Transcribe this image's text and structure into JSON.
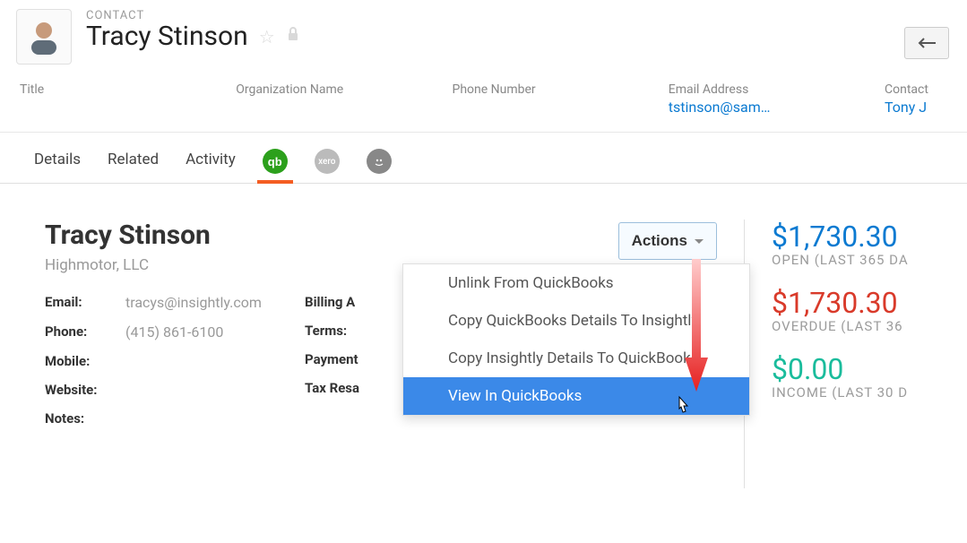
{
  "header": {
    "section_label": "CONTACT",
    "name": "Tracy Stinson"
  },
  "meta": {
    "title_label": "Title",
    "org_label": "Organization Name",
    "phone_label": "Phone Number",
    "email_label": "Email Address",
    "email_value": "tstinson@sam…",
    "owner_label": "Contact",
    "owner_value": "Tony J"
  },
  "tabs": {
    "details": "Details",
    "related": "Related",
    "activity": "Activity",
    "xero": "xero"
  },
  "panel": {
    "name": "Tracy Stinson",
    "company": "Highmotor, LLC",
    "left": {
      "email_lbl": "Email:",
      "email_val": "tracys@insightly.com",
      "phone_lbl": "Phone:",
      "phone_val": "(415) 861-6100",
      "mobile_lbl": "Mobile:",
      "website_lbl": "Website:",
      "notes_lbl": "Notes:"
    },
    "right": {
      "billing_lbl": "Billing A",
      "terms_lbl": "Terms:",
      "payment_lbl": "Payment",
      "tax_lbl": "Tax Resa"
    }
  },
  "actions": {
    "button_label": "Actions",
    "items": {
      "unlink": "Unlink From QuickBooks",
      "copy_qb": "Copy QuickBooks Details To Insightly",
      "copy_insightly": "Copy Insightly Details To QuickBooks",
      "view": "View In QuickBooks"
    }
  },
  "stats": {
    "open_value": "$1,730.30",
    "open_label": "OPEN (LAST 365 DA",
    "overdue_value": "$1,730.30",
    "overdue_label": "OVERDUE (LAST 36",
    "income_value": "$0.00",
    "income_label": "INCOME (LAST 30 D"
  }
}
